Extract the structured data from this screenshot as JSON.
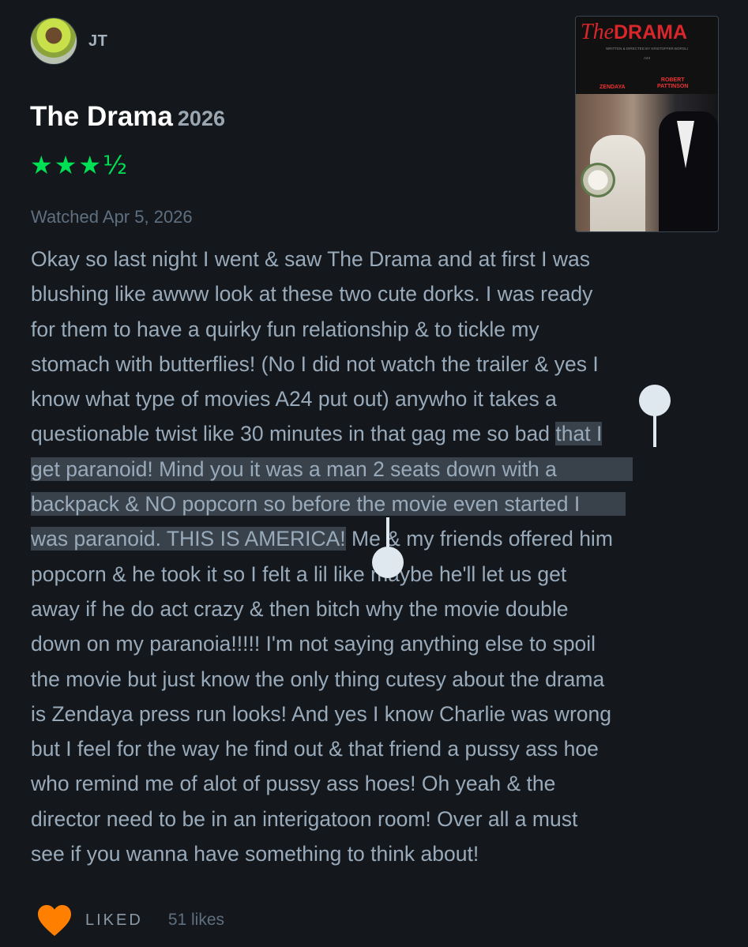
{
  "user": {
    "name": "JT"
  },
  "film": {
    "title": "The Drama",
    "year": "2026",
    "rating_stars": "★★★½",
    "rating_value": 3.5
  },
  "watched": "Watched Apr 5, 2026",
  "poster": {
    "title_italic": "The",
    "title_bold": "DRAMA",
    "credit": "WRITTEN & DIRECTED BY KRISTOFFER BORGLI",
    "studio": "A24",
    "actor1": "ZENDAYA",
    "actor2_line1": "ROBERT",
    "actor2_line2": "PATTINSON"
  },
  "review": {
    "lines": [
      "Okay so last night I went & saw The Drama and at first I was",
      "blushing like awww look at these two cute dorks. I was ready",
      "for them to have a quirky fun relationship & to tickle my",
      "stomach with butterflies! (No I did not watch the trailer & yes I",
      "know what type of movies A24 put out) anywho it takes a",
      "questionable twist like 30 minutes in that gag me so bad ",
      "that I",
      "get paranoid! Mind you it was a man 2 seats down with a",
      "backpack & NO popcorn so before the movie even started I",
      "was paranoid. THIS IS AMERICA!",
      " Me & my friends offered him",
      "popcorn & he took it so I felt a lil like maybe he'll let us get",
      "away if he do act crazy & then bitch why the movie double",
      "down on my paranoia!!!!! I'm not saying anything else to spoil",
      "the movie but just know the only thing cutesy about the drama",
      "is Zendaya press run looks! And yes I know Charlie was wrong",
      "but I feel for the way he find out & that friend a pussy ass hoe",
      "who remind me of alot of pussy ass hoes! Oh yeah & the",
      "director need to be in an interigatoon room! Over all a must",
      "see if you wanna have something to think about!"
    ]
  },
  "footer": {
    "liked_label": "LIKED",
    "likes_count": "51 likes"
  },
  "colors": {
    "background": "#14181c",
    "star_green": "#00e054",
    "heart_orange": "#ff8000",
    "selection": "#39424b"
  }
}
